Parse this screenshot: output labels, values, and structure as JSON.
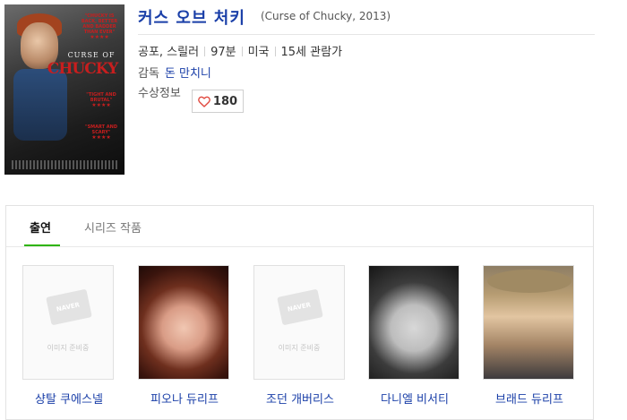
{
  "movie": {
    "title_ko": "커스 오브 처키",
    "title_en": "(Curse of Chucky, 2013)",
    "genre": "공포, 스릴러",
    "runtime": "97분",
    "country": "미국",
    "rating": "15세 관람가",
    "director_label": "감독",
    "director_name": "돈 만치니",
    "award_label": "수상정보",
    "like_count": "180",
    "poster": {
      "curse_of": "CURSE OF",
      "chucky": "CHUCKY",
      "quote_1": "\"CHUCKY IS BACK, BETTER AND BADDER THAN EVER\"",
      "quote_2": "\"TIGHT AND BRUTAL\"",
      "quote_3": "\"SMART AND SCARY\"",
      "stars": "★★★★"
    }
  },
  "tabs": [
    {
      "label": "출연",
      "active": true
    },
    {
      "label": "시리즈 작품",
      "active": false
    }
  ],
  "placeholder": {
    "logo": "NAVER",
    "text": "이미지 준비중"
  },
  "cast": [
    {
      "name": "샹탈 쿠에스넬",
      "photo": "placeholder"
    },
    {
      "name": "피오나 듀리프",
      "photo": "photo"
    },
    {
      "name": "조던 개버리스",
      "photo": "placeholder"
    },
    {
      "name": "다니엘 비서티",
      "photo": "photo"
    },
    {
      "name": "브래드 듀리프",
      "photo": "photo"
    }
  ],
  "colors": {
    "link": "#1a3fa8",
    "tab_accent": "#2db400",
    "heart": "#e0483e"
  }
}
